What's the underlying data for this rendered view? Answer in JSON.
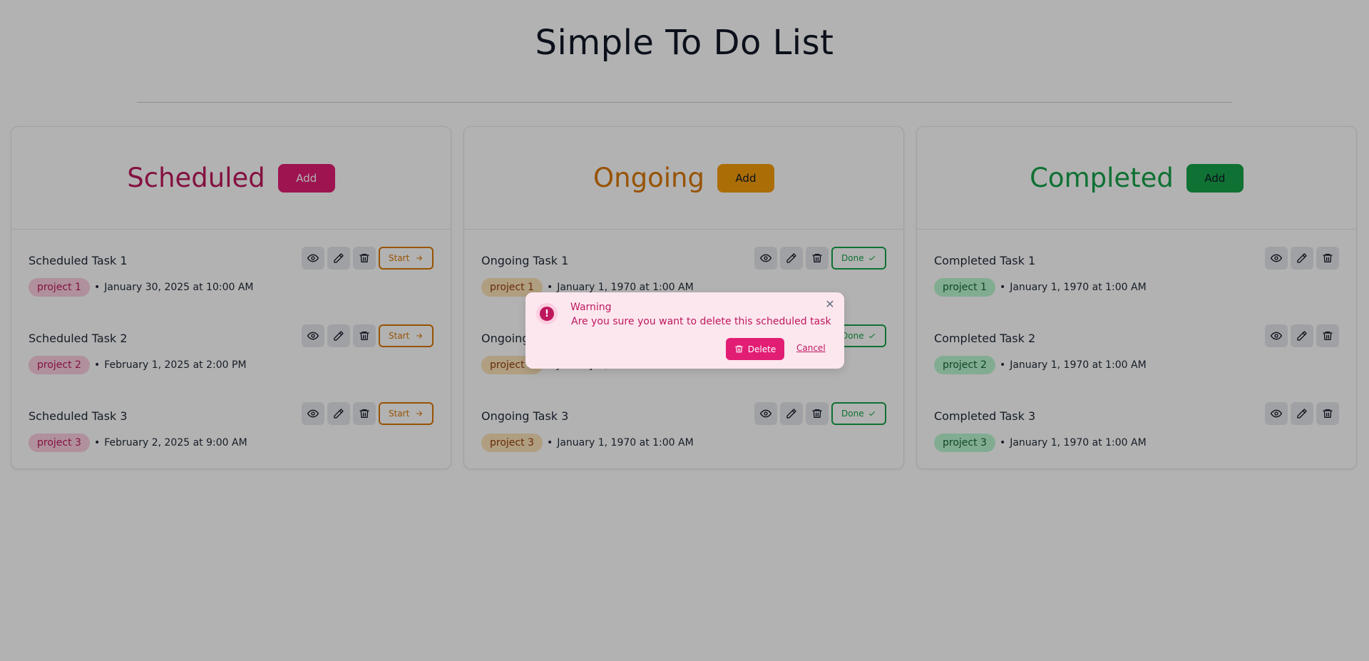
{
  "page": {
    "title": "Simple To Do List"
  },
  "columns": [
    {
      "title": "Scheduled",
      "add_label": "Add",
      "title_color": "#be185d",
      "add_bg": "#e11d74",
      "add_fg": "#ffffff",
      "tag_bg": "#fbcfe0",
      "tag_fg": "#be185d",
      "state_button": {
        "label": "Start",
        "icon": "arrow-right-icon",
        "color": "#d97706"
      },
      "tasks": [
        {
          "name": "Scheduled Task 1",
          "project": "project 1",
          "date": "January 30, 2025 at 10:00 AM"
        },
        {
          "name": "Scheduled Task 2",
          "project": "project 2",
          "date": "February 1, 2025 at 2:00 PM"
        },
        {
          "name": "Scheduled Task 3",
          "project": "project 3",
          "date": "February 2, 2025 at 9:00 AM"
        }
      ]
    },
    {
      "title": "Ongoing",
      "add_label": "Add",
      "title_color": "#d97706",
      "add_bg": "#f59e0b",
      "add_fg": "#111827",
      "tag_bg": "#fde2b8",
      "tag_fg": "#92400e",
      "state_button": {
        "label": "Done",
        "icon": "check-icon",
        "color": "#16a34a"
      },
      "tasks": [
        {
          "name": "Ongoing Task 1",
          "project": "project 1",
          "date": "January 1, 1970 at 1:00 AM"
        },
        {
          "name": "Ongoing Task 2",
          "project": "project 2",
          "date": "January 1, 1970 at 1:00 AM"
        },
        {
          "name": "Ongoing Task 3",
          "project": "project 3",
          "date": "January 1, 1970 at 1:00 AM"
        }
      ]
    },
    {
      "title": "Completed",
      "add_label": "Add",
      "title_color": "#16a34a",
      "add_bg": "#16a34a",
      "add_fg": "#111827",
      "tag_bg": "#bbf7d0",
      "tag_fg": "#166534",
      "state_button": null,
      "tasks": [
        {
          "name": "Completed Task 1",
          "project": "project 1",
          "date": "January 1, 1970 at 1:00 AM"
        },
        {
          "name": "Completed Task 2",
          "project": "project 2",
          "date": "January 1, 1970 at 1:00 AM"
        },
        {
          "name": "Completed Task 3",
          "project": "project 3",
          "date": "January 1, 1970 at 1:00 AM"
        }
      ]
    }
  ],
  "modal": {
    "title": "Warning",
    "message": "Are you sure you want to delete this scheduled task",
    "delete_label": "Delete",
    "cancel_label": "Cancel",
    "close_glyph": "✕",
    "badge_glyph": "!"
  },
  "icons": {
    "view": "eye-icon",
    "edit": "pencil-icon",
    "delete": "trash-icon"
  }
}
